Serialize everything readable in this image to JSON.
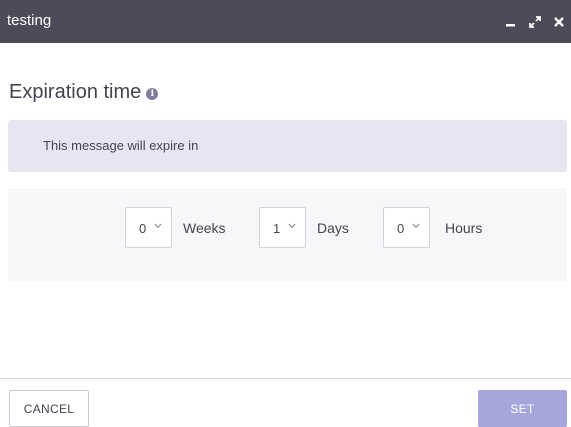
{
  "window": {
    "title": "testing",
    "controls": {
      "minimize_icon": "minimize-icon",
      "expand_icon": "expand-icon",
      "close_icon": "close-icon"
    }
  },
  "main": {
    "heading": "Expiration time",
    "info_glyph": "i",
    "notice": "This message will expire in",
    "fields": [
      {
        "value": "0",
        "unit": "Weeks"
      },
      {
        "value": "1",
        "unit": "Days"
      },
      {
        "value": "0",
        "unit": "Hours"
      }
    ]
  },
  "footer": {
    "cancel_label": "CANCEL",
    "set_label": "SET"
  },
  "colors": {
    "titlebar": "#4c4b59",
    "notice_bg": "#e6e6f2",
    "primary_button": "#a7a6da",
    "text": "#444350"
  }
}
